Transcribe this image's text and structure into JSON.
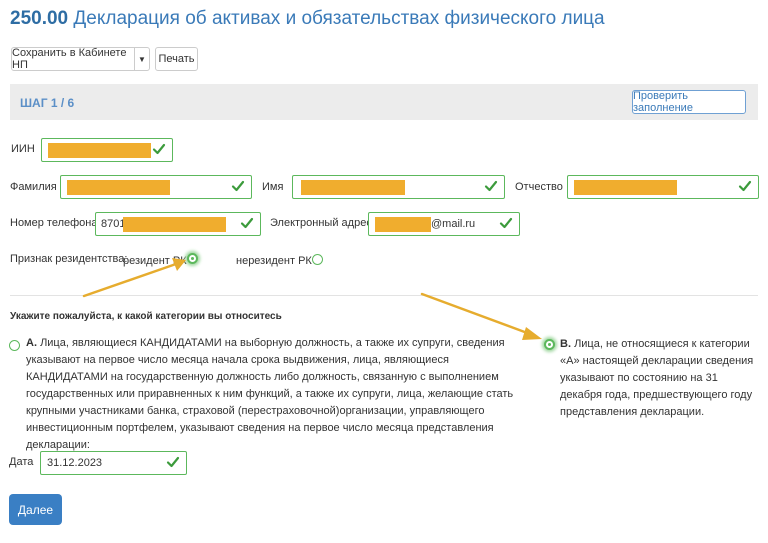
{
  "header": {
    "code": "250.00",
    "title": "Декларация об активах и обязательствах физического лица"
  },
  "toolbar": {
    "save_label": "Сохранить в Кабинете НП",
    "dropdown_icon": "caret-down-icon",
    "print_label": "Печать"
  },
  "step": {
    "label": "ШАГ 1 / 6",
    "check_button": "Проверить заполнение"
  },
  "form": {
    "iin_label": "ИИН",
    "surname_label": "Фамилия",
    "name_label": "Имя",
    "patronymic_label": "Отчество",
    "phone_label": "Номер телефона",
    "phone_value": "8701",
    "email_label": "Электронный адрес",
    "email_value": "@mail.ru",
    "residency_label": "Признак резидентства:",
    "resident_label": "резидент РК",
    "nonresident_label": "нерезидент РК",
    "resident_selected": true
  },
  "category": {
    "prompt": "Укажите пожалуйста, к какой категории вы относитесь",
    "a_letter": "А.",
    "a_text": "Лица, являющиеся КАНДИДАТАМИ на выборную должность, а также их супруги, сведения указывают на первое число месяца начала срока выдвижения, лица, являющиеся КАНДИДАТАМИ на государственную должность либо должность, связанную с выполнением государственных или приравненных к ним функций, а также их супруги, лица, желающие стать крупными участниками банка, страховой (перестраховочной)организации, управляющего инвестиционным портфелем, указывают сведения на первое число месяца представления декларации:",
    "b_letter": "В.",
    "b_text": "Лица, не относящиеся к категории «А» настоящей декларации сведения указывают по состоянию на 31 декабря года, предшествующего году представления декларации.",
    "date_label": "Дата",
    "date_value": "31.12.2023",
    "selected": "B"
  },
  "next_label": "Далее",
  "colors": {
    "accent": "#3a7ab8",
    "valid": "#5cb85c",
    "redaction": "#f0ad2e",
    "annotation_arrow": "#e6ac2e"
  }
}
